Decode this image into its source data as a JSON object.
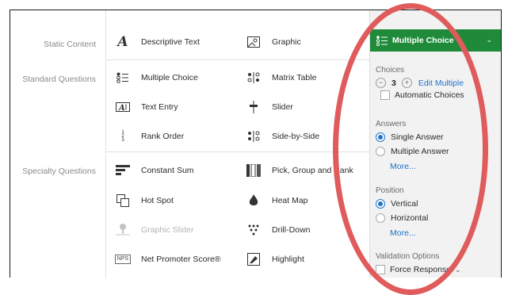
{
  "categories": {
    "static": "Static Content",
    "standard": "Standard Questions",
    "specialty": "Specialty Questions"
  },
  "items": [
    {
      "label": "Descriptive Text",
      "icon": "descriptive-text-icon",
      "disabled": false
    },
    {
      "label": "Graphic",
      "icon": "graphic-icon",
      "disabled": false
    },
    {
      "label": "Multiple Choice",
      "icon": "multiple-choice-icon",
      "disabled": false
    },
    {
      "label": "Matrix Table",
      "icon": "matrix-table-icon",
      "disabled": false
    },
    {
      "label": "Text Entry",
      "icon": "text-entry-icon",
      "disabled": false
    },
    {
      "label": "Slider",
      "icon": "slider-icon",
      "disabled": false
    },
    {
      "label": "Rank Order",
      "icon": "rank-order-icon",
      "disabled": false
    },
    {
      "label": "Side-by-Side",
      "icon": "side-by-side-icon",
      "disabled": false
    },
    {
      "label": "Constant Sum",
      "icon": "constant-sum-icon",
      "disabled": false
    },
    {
      "label": "Pick, Group and Rank",
      "icon": "pick-group-rank-icon",
      "disabled": false
    },
    {
      "label": "Hot Spot",
      "icon": "hot-spot-icon",
      "disabled": false
    },
    {
      "label": "Heat Map",
      "icon": "heat-map-icon",
      "disabled": false
    },
    {
      "label": "Graphic Slider",
      "icon": "graphic-slider-icon",
      "disabled": true
    },
    {
      "label": "Drill-Down",
      "icon": "drill-down-icon",
      "disabled": false
    },
    {
      "label": "Net Promoter Score®",
      "icon": "nps-icon",
      "icon_text": "NPS",
      "disabled": false
    },
    {
      "label": "Highlight",
      "icon": "highlight-icon",
      "disabled": false
    }
  ],
  "panel": {
    "question_type": "Multiple Choice",
    "choices_title": "Choices",
    "choice_count": "3",
    "edit_multiple": "Edit Multiple",
    "automatic_choices": "Automatic Choices",
    "answers_title": "Answers",
    "single_answer": "Single Answer",
    "multiple_answer": "Multiple Answer",
    "more": "More...",
    "position_title": "Position",
    "vertical": "Vertical",
    "horizontal": "Horizontal",
    "validation_title": "Validation Options",
    "force_response": "Force Response",
    "answers_selected": "Single Answer",
    "position_selected": "Vertical"
  },
  "colors": {
    "accent_green": "#1f8a3a",
    "link_blue": "#1e73c8",
    "annotation_red": "#e05b5b"
  }
}
